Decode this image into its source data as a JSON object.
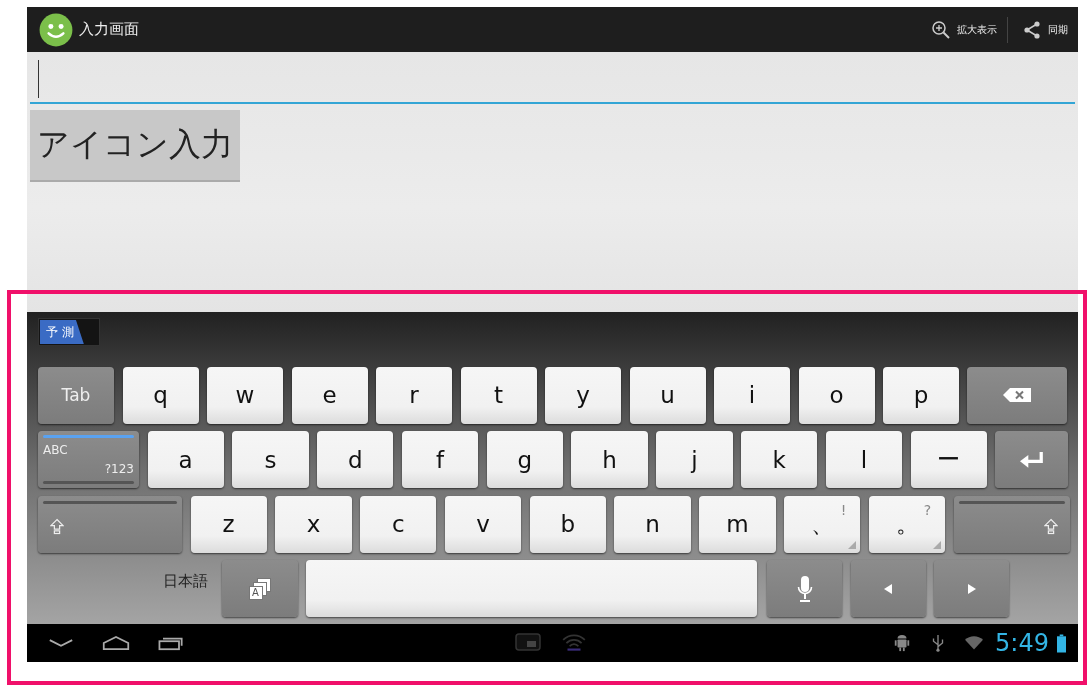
{
  "app_bar": {
    "title": "入力画面",
    "actions": [
      {
        "kind": "zoom",
        "label": "拡大表示"
      },
      {
        "kind": "share",
        "label": "同期"
      }
    ]
  },
  "text_field": {
    "focused": true
  },
  "icon_input_button": {
    "label": "アイコン入力"
  },
  "keyboard": {
    "prediction_tab": {
      "label": "予 測"
    },
    "rows": [
      [
        {
          "kind": "tab",
          "label": "Tab"
        },
        {
          "kind": "char",
          "label": "q"
        },
        {
          "kind": "char",
          "label": "w"
        },
        {
          "kind": "char",
          "label": "e"
        },
        {
          "kind": "char",
          "label": "r"
        },
        {
          "kind": "char",
          "label": "t"
        },
        {
          "kind": "char",
          "label": "y"
        },
        {
          "kind": "char",
          "label": "u"
        },
        {
          "kind": "char",
          "label": "i"
        },
        {
          "kind": "char",
          "label": "o"
        },
        {
          "kind": "char",
          "label": "p"
        },
        {
          "kind": "backspace"
        }
      ],
      [
        {
          "kind": "mode",
          "label": "ABC",
          "sublabel": "?123"
        },
        {
          "kind": "char",
          "label": "a"
        },
        {
          "kind": "char",
          "label": "s"
        },
        {
          "kind": "char",
          "label": "d"
        },
        {
          "kind": "char",
          "label": "f"
        },
        {
          "kind": "char",
          "label": "g"
        },
        {
          "kind": "char",
          "label": "h"
        },
        {
          "kind": "char",
          "label": "j"
        },
        {
          "kind": "char",
          "label": "k"
        },
        {
          "kind": "char",
          "label": "l"
        },
        {
          "kind": "char",
          "label": "ー"
        },
        {
          "kind": "enter"
        }
      ],
      [
        {
          "kind": "shift-left"
        },
        {
          "kind": "char",
          "label": "z"
        },
        {
          "kind": "char",
          "label": "x"
        },
        {
          "kind": "char",
          "label": "c"
        },
        {
          "kind": "char",
          "label": "v"
        },
        {
          "kind": "char",
          "label": "b"
        },
        {
          "kind": "char",
          "label": "n"
        },
        {
          "kind": "char",
          "label": "m"
        },
        {
          "kind": "char",
          "label": "、",
          "hint": "!"
        },
        {
          "kind": "char",
          "label": "。",
          "hint": "?"
        },
        {
          "kind": "shift-right"
        }
      ],
      [
        {
          "kind": "label",
          "label": "日本語"
        },
        {
          "kind": "kana",
          "label": "A"
        },
        {
          "kind": "space"
        },
        {
          "kind": "mic"
        },
        {
          "kind": "left"
        },
        {
          "kind": "right"
        }
      ]
    ]
  },
  "nav_bar": {
    "time": "5:49"
  }
}
